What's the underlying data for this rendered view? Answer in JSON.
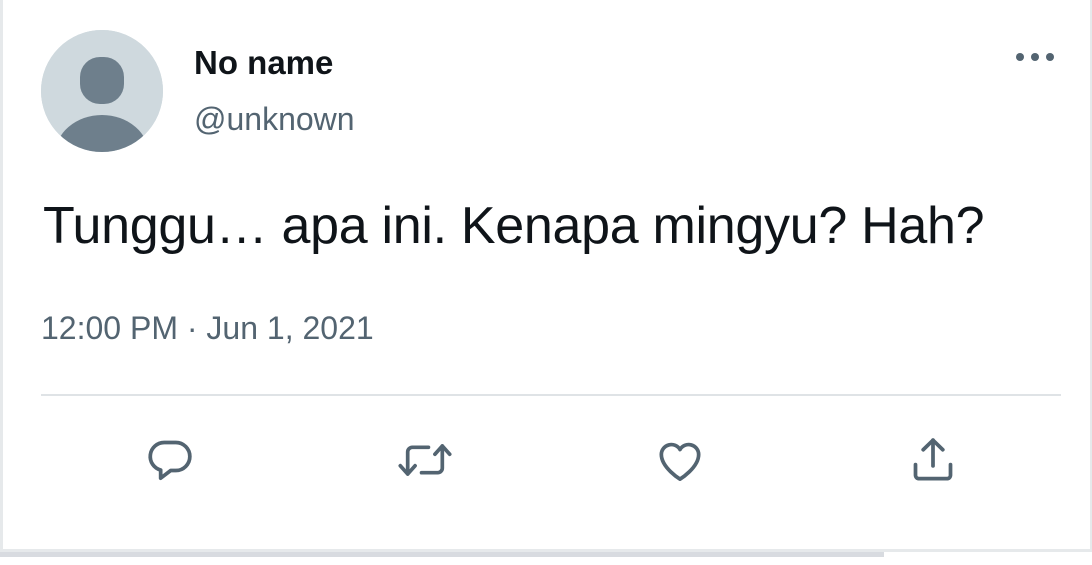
{
  "tweet": {
    "display_name": "No name",
    "handle": "@unknown",
    "text": "Tunggu… apa ini. Kenapa mingyu? Hah?",
    "timestamp": "12:00 PM",
    "separator": "·",
    "date": "Jun 1, 2021"
  },
  "actions": {
    "reply_icon": "reply-icon",
    "retweet_icon": "retweet-icon",
    "like_icon": "heart-icon",
    "share_icon": "share-icon"
  },
  "colors": {
    "text_primary": "#0f1419",
    "text_secondary": "#536471",
    "avatar_bg": "#cfd9de",
    "avatar_fg": "#6e7f8c",
    "divider": "#dfe3e6"
  }
}
